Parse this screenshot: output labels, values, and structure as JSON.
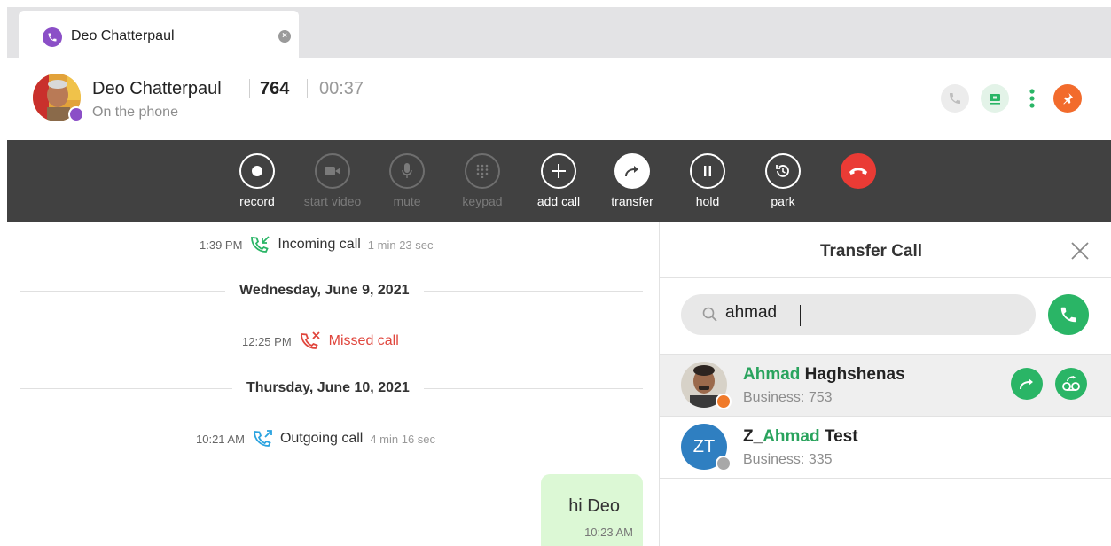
{
  "tab": {
    "title": "Deo Chatterpaul"
  },
  "header": {
    "name": "Deo Chatterpaul",
    "extension": "764",
    "timer": "00:37",
    "status": "On the phone"
  },
  "toolbar": {
    "items": [
      {
        "label": "record",
        "icon": "record-icon",
        "enabled": true
      },
      {
        "label": "start video",
        "icon": "video-camera-icon",
        "enabled": false
      },
      {
        "label": "mute",
        "icon": "microphone-icon",
        "enabled": false
      },
      {
        "label": "keypad",
        "icon": "keypad-icon",
        "enabled": false
      },
      {
        "label": "add call",
        "icon": "plus-icon",
        "enabled": true
      },
      {
        "label": "transfer",
        "icon": "transfer-arrow-icon",
        "enabled": true
      },
      {
        "label": "hold",
        "icon": "pause-icon",
        "enabled": true
      },
      {
        "label": "park",
        "icon": "park-clock-icon",
        "enabled": true
      },
      {
        "label": "",
        "icon": "hang-up-icon",
        "enabled": true
      }
    ]
  },
  "conversation": {
    "incoming": {
      "time": "1:39 PM",
      "label": "Incoming call",
      "duration": "1 min 23 sec"
    },
    "date1": "Wednesday, June 9, 2021",
    "missed": {
      "time": "12:25 PM",
      "label": "Missed call"
    },
    "date2": "Thursday, June 10, 2021",
    "outgoing": {
      "time": "10:21 AM",
      "label": "Outgoing call",
      "duration": "4 min 16 sec"
    },
    "message": {
      "text": "hi Deo",
      "time": "10:23 AM"
    }
  },
  "transfer": {
    "title": "Transfer Call",
    "search_value": "ahmad",
    "results": [
      {
        "match": "Ahmad",
        "rest": " Haghshenas",
        "prefix": "",
        "sub": "Business: 753",
        "initials": ""
      },
      {
        "prefix": "Z_",
        "match": "Ahmad",
        "rest": " Test",
        "sub": "Business: 335",
        "initials": "ZT"
      }
    ]
  },
  "colors": {
    "accent_green": "#2ab566",
    "hangup_red": "#ea3b35",
    "brand_purple": "#8b4fc7",
    "toolbar_bg": "#414141",
    "pin_orange": "#f26b2c"
  }
}
